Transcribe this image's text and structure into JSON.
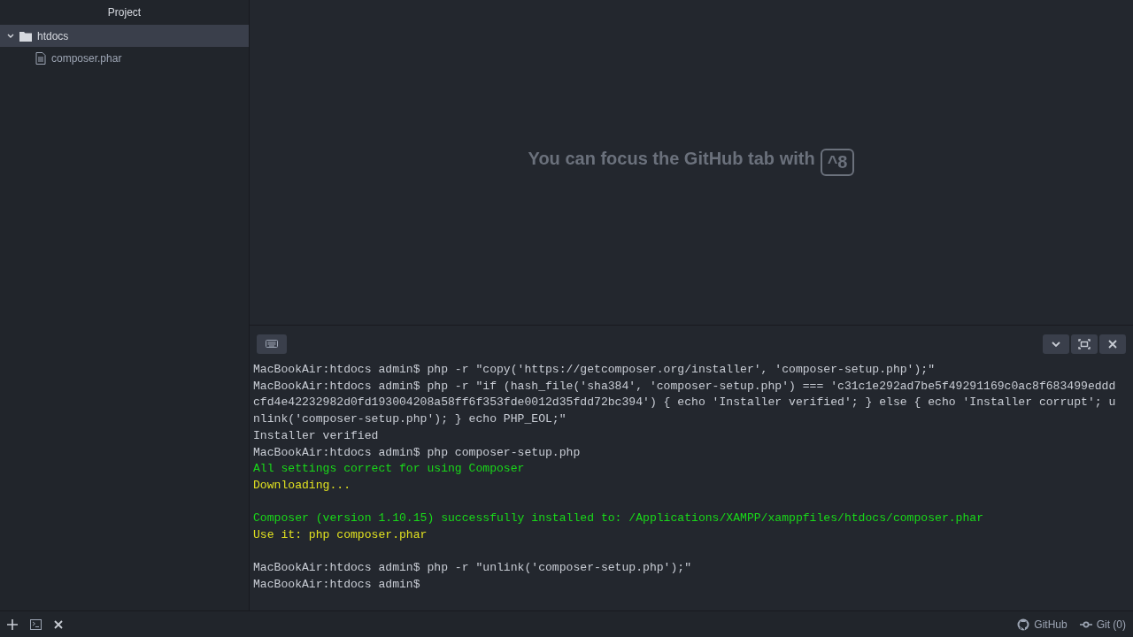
{
  "sidebar": {
    "title": "Project",
    "tree": [
      {
        "label": "htdocs",
        "kind": "folder",
        "expanded": true,
        "selected": true,
        "children": [
          {
            "label": "composer.phar",
            "kind": "file",
            "selected": false
          }
        ]
      }
    ]
  },
  "hint": {
    "text": "You can focus the GitHub tab with",
    "key": "^8"
  },
  "terminal": {
    "lines": [
      {
        "kind": "plain",
        "text": "MacBookAir:htdocs admin$ php -r \"copy('https://getcomposer.org/installer', 'composer-setup.php');\""
      },
      {
        "kind": "plain",
        "text": "MacBookAir:htdocs admin$ php -r \"if (hash_file('sha384', 'composer-setup.php') === 'c31c1e292ad7be5f49291169c0ac8f683499eddd"
      },
      {
        "kind": "plain",
        "text": "cfd4e42232982d0fd193004208a58ff6f353fde0012d35fdd72bc394') { echo 'Installer verified'; } else { echo 'Installer corrupt'; u"
      },
      {
        "kind": "plain",
        "text": "nlink('composer-setup.php'); } echo PHP_EOL;\""
      },
      {
        "kind": "plain",
        "text": "Installer verified"
      },
      {
        "kind": "plain",
        "text": "MacBookAir:htdocs admin$ php composer-setup.php"
      },
      {
        "kind": "success",
        "text": "All settings correct for using Composer"
      },
      {
        "kind": "info",
        "text": "Downloading..."
      },
      {
        "kind": "blank"
      },
      {
        "kind": "success",
        "text": "Composer (version 1.10.15) successfully installed to: /Applications/XAMPP/xamppfiles/htdocs/composer.phar"
      },
      {
        "kind": "info",
        "text": "Use it: php composer.phar"
      },
      {
        "kind": "blank"
      },
      {
        "kind": "plain",
        "text": "MacBookAir:htdocs admin$ php -r \"unlink('composer-setup.php');\""
      },
      {
        "kind": "plain",
        "text": "MacBookAir:htdocs admin$"
      }
    ]
  },
  "status_bar": {
    "github": "GitHub",
    "git": "Git (0)"
  }
}
